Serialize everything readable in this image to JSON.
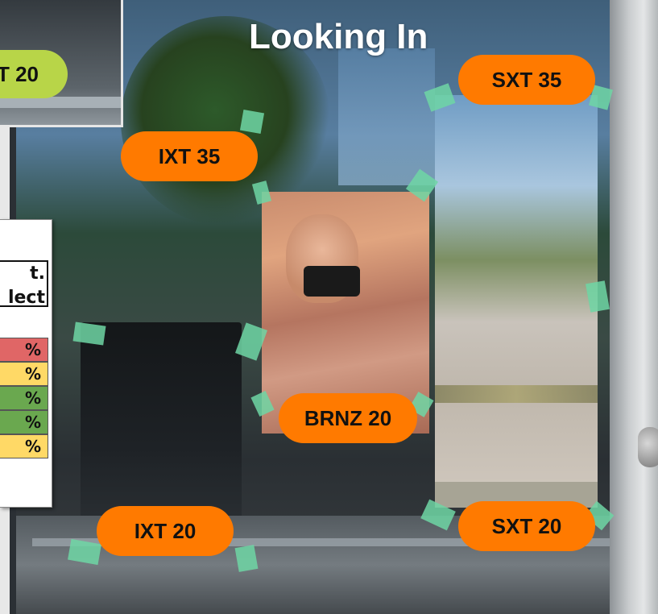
{
  "title": "Looking In",
  "labels": {
    "sxt35": "SXT 35",
    "ixt35": "IXT 35",
    "brnz20": "BRNZ 20",
    "ixt20": "IXT 20",
    "sxt20": "SXT 20",
    "inset_ixt20_partial": "T 20"
  },
  "table": {
    "header_line1": "t.",
    "header_line2": "lect",
    "rows": [
      {
        "text": "%",
        "color": "#e06666"
      },
      {
        "text": "%",
        "color": "#ffd966"
      },
      {
        "text": "%",
        "color": "#6aa84f"
      },
      {
        "text": "%",
        "color": "#6aa84f"
      },
      {
        "text": "%",
        "color": "#ffd966"
      }
    ]
  },
  "colors": {
    "label_orange": "#ff7a00",
    "label_green": "#b8d548",
    "tape": "#6fd6a4"
  }
}
